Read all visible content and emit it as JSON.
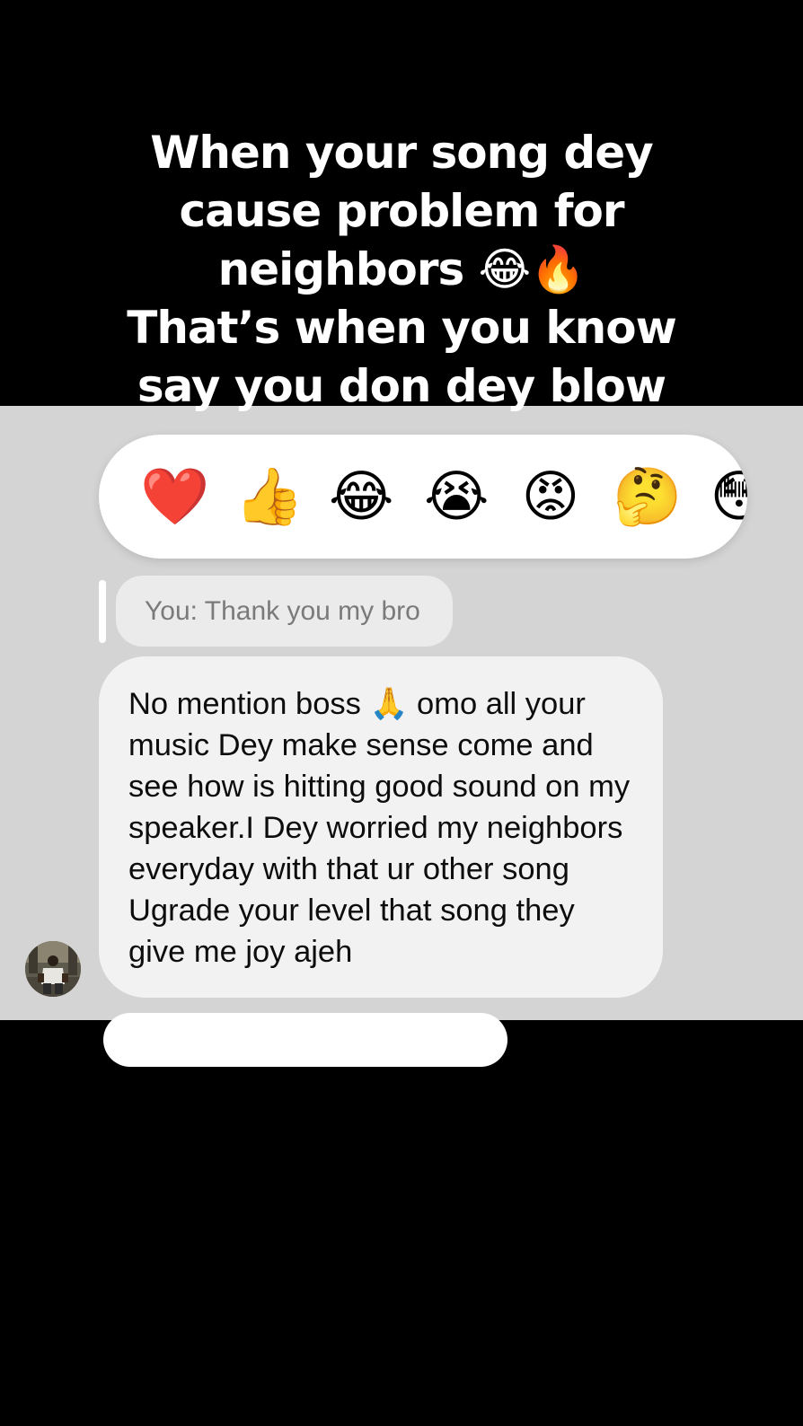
{
  "caption": {
    "lines": [
      "When your song dey",
      "cause problem for",
      "neighbors 😂🔥",
      "That’s when you know",
      "say you don dey blow"
    ]
  },
  "reactions": [
    {
      "emoji": "❤️",
      "icon": "red-heart-icon"
    },
    {
      "emoji": "👍",
      "icon": "thumbs-up-icon"
    },
    {
      "emoji": "😂",
      "icon": "tears-of-joy-icon"
    },
    {
      "emoji": "😭",
      "icon": "loudly-crying-icon"
    },
    {
      "emoji": "😡",
      "icon": "angry-face-icon"
    },
    {
      "emoji": "🤔",
      "icon": "thinking-face-icon"
    },
    {
      "emoji": "😳",
      "icon": "flushed-face-icon"
    }
  ],
  "reply": {
    "text": "You: Thank you my bro"
  },
  "message": {
    "text": "No mention boss 🙏 omo all your music Dey make sense come and see how is hitting good sound on my speaker.I Dey worried my neighbors everyday with that ur other song Ugrade your level that song they give me joy ajeh"
  },
  "colors": {
    "chat_background": "#d4d4d4",
    "message_bubble": "#f2f2f2",
    "reply_bubble": "#ebebeb",
    "caption_text": "#ffffff"
  }
}
